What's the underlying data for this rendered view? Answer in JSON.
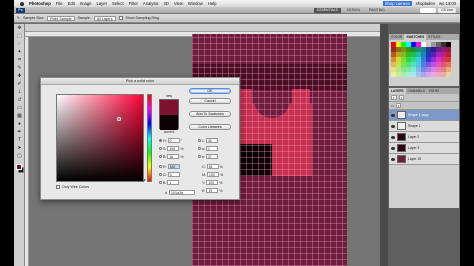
{
  "menubar": {
    "app": "Photoshop",
    "items": [
      "File",
      "Edit",
      "Image",
      "Layer",
      "Select",
      "Filter",
      "Analysis",
      "3D",
      "View",
      "Window",
      "Help"
    ],
    "right_items": [
      "Shop camera",
      "shopladen",
      "wo 13:03"
    ]
  },
  "appbar": {
    "logo": "Ps",
    "workspaces": [
      "ESSENTIALS",
      "DESIGN",
      "PAINTING"
    ],
    "active_workspace": "ESSENTIALS",
    "cs_live": "CS Live"
  },
  "options": {
    "sample_size_label": "Sample Size:",
    "sample_size_value": "Point Sample",
    "sample_label": "Sample:",
    "sample_value": "All Layers",
    "show_ring_label": "Show Sampling Ring"
  },
  "picker": {
    "title": "Pick a solid color",
    "new_label": "new",
    "current_label": "current",
    "buttons": [
      "OK",
      "Cancel",
      "Add To Swatches",
      "Color Libraries"
    ],
    "fields_left": [
      {
        "label": "H:",
        "value": "0",
        "unit": "°",
        "on": true
      },
      {
        "label": "S:",
        "value": "100",
        "unit": "%",
        "on": false
      },
      {
        "label": "B:",
        "value": "16",
        "unit": "%",
        "on": false
      },
      {
        "label": "R:",
        "value": "182",
        "unit": "",
        "on": false
      },
      {
        "label": "G:",
        "value": "0",
        "unit": "",
        "on": false
      },
      {
        "label": "B:",
        "value": "1",
        "unit": "",
        "on": false
      }
    ],
    "fields_right": [
      {
        "label": "L:",
        "value": "30",
        "unit": ""
      },
      {
        "label": "a:",
        "value": "1",
        "unit": ""
      },
      {
        "label": "b:",
        "value": "37",
        "unit": ""
      },
      {
        "label": "C:",
        "value": "46",
        "unit": "%"
      },
      {
        "label": "M:",
        "value": "100",
        "unit": "%"
      },
      {
        "label": "Y:",
        "value": "100",
        "unit": "%"
      },
      {
        "label": "K:",
        "value": "19",
        "unit": "%"
      }
    ],
    "hex": "101a3a",
    "only_web_colors": "Only Web Colors",
    "new_color": "#7e1030",
    "current_color": "#0a0204"
  },
  "panels": {
    "swatch_tabs": [
      "COLOR",
      "SWATCHES",
      "STYLES"
    ],
    "active_swatch_tab": "SWATCHES",
    "layers_tabs": [
      "LAYERS",
      "CHANNELS",
      "PATHS"
    ],
    "active_layers_tab": "LAYERS",
    "layers": [
      {
        "name": "Shape 1 copy",
        "thumb": "white",
        "selected": true
      },
      {
        "name": "Shape 1",
        "thumb": "white",
        "selected": false
      },
      {
        "name": "Layer 2",
        "thumb": "dark",
        "selected": false
      },
      {
        "name": "Layer 3",
        "thumb": "dark",
        "selected": false
      },
      {
        "name": "Layer 19",
        "thumb": "red",
        "selected": false
      }
    ]
  }
}
